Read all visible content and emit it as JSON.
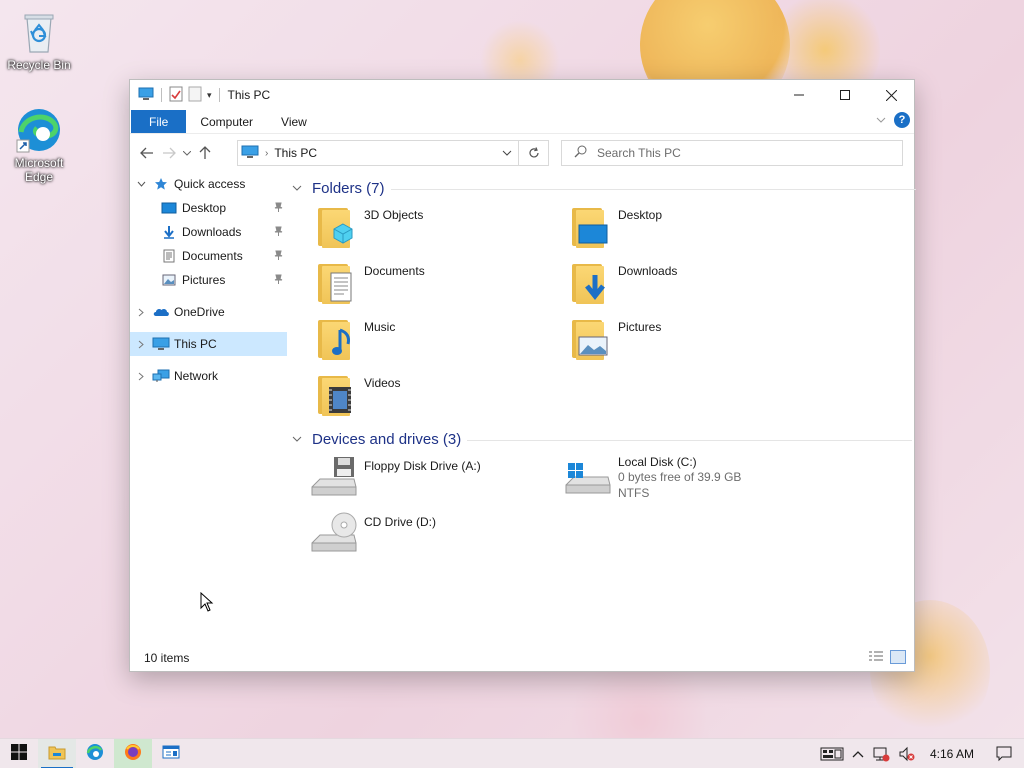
{
  "desktop": {
    "icons": [
      {
        "label": "Recycle Bin",
        "icon": "recycle-bin-icon"
      },
      {
        "label": "Microsoft Edge",
        "icon": "edge-icon"
      }
    ]
  },
  "window": {
    "title": "This PC",
    "ribbon": {
      "tabs": [
        "File",
        "Computer",
        "View"
      ],
      "help": "?"
    },
    "address": {
      "path": "This PC"
    },
    "search": {
      "placeholder": "Search This PC"
    },
    "nav_pane": {
      "quick_access": "Quick access",
      "pinned": [
        {
          "label": "Desktop",
          "icon": "desktop-icon"
        },
        {
          "label": "Downloads",
          "icon": "downloads-icon"
        },
        {
          "label": "Documents",
          "icon": "documents-icon"
        },
        {
          "label": "Pictures",
          "icon": "pictures-icon"
        }
      ],
      "onedrive": "OneDrive",
      "this_pc": "This PC",
      "network": "Network"
    },
    "folders": {
      "header": "Folders (7)",
      "items": [
        {
          "label": "3D Objects",
          "icon": "3d-objects-folder-icon"
        },
        {
          "label": "Desktop",
          "icon": "desktop-folder-icon"
        },
        {
          "label": "Documents",
          "icon": "documents-folder-icon"
        },
        {
          "label": "Downloads",
          "icon": "downloads-folder-icon"
        },
        {
          "label": "Music",
          "icon": "music-folder-icon"
        },
        {
          "label": "Pictures",
          "icon": "pictures-folder-icon"
        },
        {
          "label": "Videos",
          "icon": "videos-folder-icon"
        }
      ]
    },
    "devices": {
      "header": "Devices and drives (3)",
      "items": [
        {
          "label": "Floppy Disk Drive (A:)",
          "icon": "floppy-drive-icon"
        },
        {
          "label": "Local Disk (C:)",
          "free": "0 bytes free of 39.9 GB",
          "fs": "NTFS",
          "icon": "local-disk-icon"
        },
        {
          "label": "CD Drive (D:)",
          "icon": "cd-drive-icon"
        }
      ]
    },
    "status": "10 items"
  },
  "taskbar": {
    "clock": "4:16 AM",
    "items": [
      "start-icon",
      "file-explorer-icon",
      "edge-icon",
      "firefox-icon",
      "app-window-icon"
    ]
  },
  "colors": {
    "accent": "#1a6fc6",
    "selection": "#cce8ff",
    "group_header": "#1e3287"
  }
}
